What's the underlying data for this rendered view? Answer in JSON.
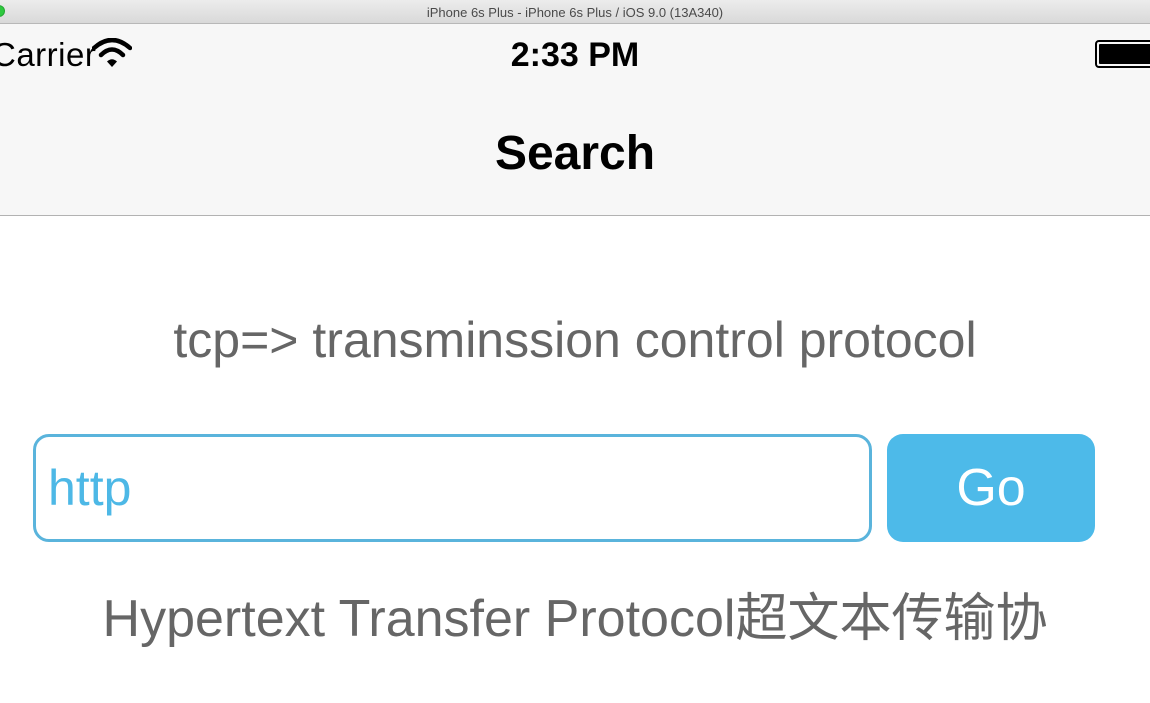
{
  "simulator": {
    "window_title": "iPhone 6s Plus - iPhone 6s Plus / iOS 9.0 (13A340)"
  },
  "status_bar": {
    "carrier": "Carrier",
    "time": "2:33 PM",
    "wifi_icon": "wifi-icon",
    "battery_icon": "battery-icon"
  },
  "nav": {
    "title": "Search"
  },
  "main": {
    "result_text": "tcp=> transminssion control protocol",
    "search_field": {
      "value": "http",
      "text_color": "#4db8e6",
      "border_color": "#5ab4dc"
    },
    "go_button": {
      "label": "Go",
      "color": "#4dbae9"
    },
    "meaning_text": "Hypertext Transfer Protocol超文本传输协"
  }
}
